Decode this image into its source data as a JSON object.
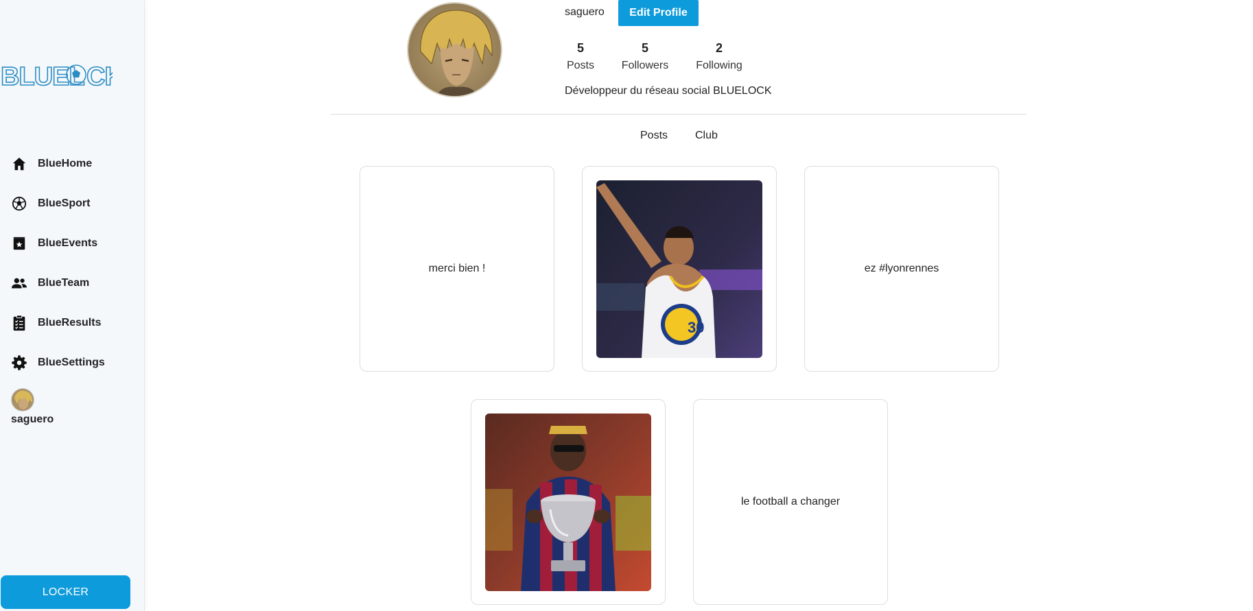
{
  "app": {
    "logo_text": "BLUELOCK",
    "accent_color": "#0d9bdb"
  },
  "sidebar": {
    "items": [
      {
        "label": "BlueHome",
        "icon": "home-icon"
      },
      {
        "label": "BlueSport",
        "icon": "soccer-ball-icon"
      },
      {
        "label": "BlueEvents",
        "icon": "calendar-star-icon"
      },
      {
        "label": "BlueTeam",
        "icon": "people-icon"
      },
      {
        "label": "BlueResults",
        "icon": "clipboard-check-icon"
      },
      {
        "label": "BlueSettings",
        "icon": "gear-icon"
      }
    ],
    "user": {
      "name": "saguero"
    },
    "locker_label": "LOCKER"
  },
  "profile": {
    "username": "saguero",
    "edit_label": "Edit Profile",
    "stats": [
      {
        "value": "5",
        "label": "Posts"
      },
      {
        "value": "5",
        "label": "Followers"
      },
      {
        "value": "2",
        "label": "Following"
      }
    ],
    "bio": "Développeur du réseau social BLUELOCK"
  },
  "tabs": [
    {
      "label": "Posts"
    },
    {
      "label": "Club"
    }
  ],
  "posts": [
    {
      "type": "text",
      "text": "merci bien !"
    },
    {
      "type": "image",
      "description": "basketball player in Warriors jersey number 30"
    },
    {
      "type": "text",
      "text": "ez #lyonrennes"
    },
    {
      "type": "image",
      "description": "football player holding trophy"
    },
    {
      "type": "text",
      "text": "le football a changer"
    }
  ]
}
